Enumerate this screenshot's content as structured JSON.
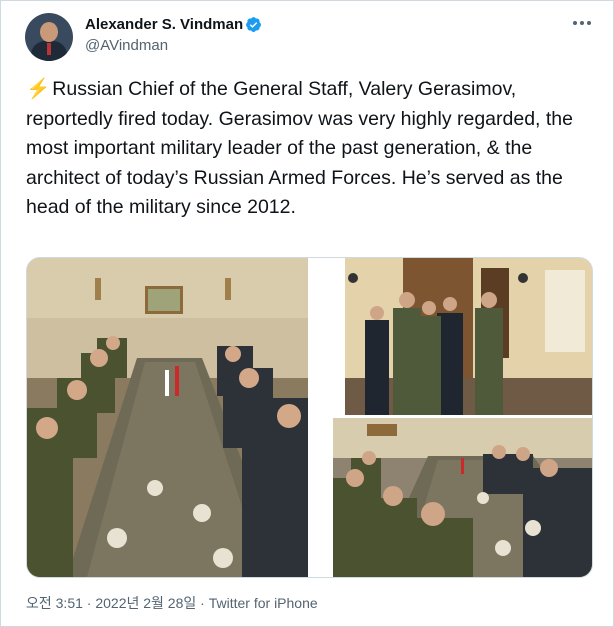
{
  "author": {
    "display_name": "Alexander S. Vindman",
    "handle": "@AVindman",
    "verified_icon": "verified-badge-icon"
  },
  "more_icon": "more-options-icon",
  "tweet": {
    "text": "Russian Chief of the General Staff, Valery Gerasimov, reportedly fired today. Gerasimov was very highly regarded, the most important military leader of the past generation, & the architect of today’s Russian Armed Forces. He’s served as the head of the military since 2012.",
    "emoji": "⚡"
  },
  "media": {
    "photos": [
      {
        "subject": "conference-table-meeting"
      },
      {
        "subject": "officers-in-hallway"
      },
      {
        "subject": "conference-table-meeting-wide"
      }
    ]
  },
  "meta": {
    "timestamp": "오전 3:51 · 2022년 2월 28일",
    "separator": " · ",
    "source": "Twitter for iPhone"
  },
  "colors": {
    "text": "#0f1419",
    "secondary": "#536471",
    "verified": "#1d9bf0",
    "border": "#cfd9de",
    "emoji": "#f5a623"
  }
}
